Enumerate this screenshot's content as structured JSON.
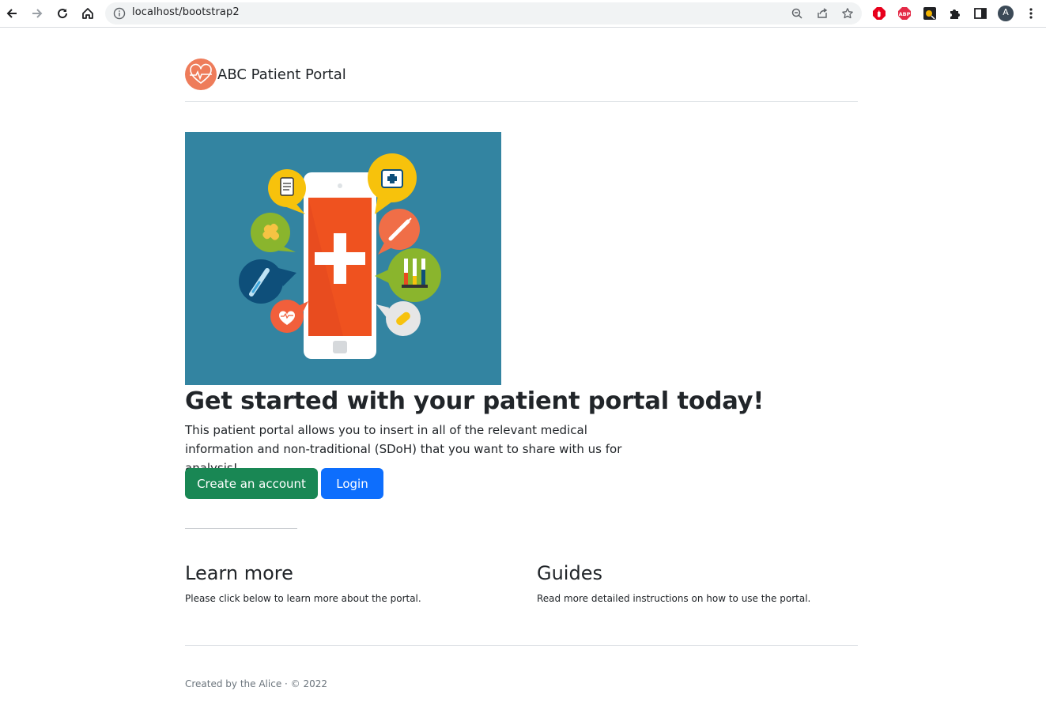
{
  "browser": {
    "url": "localhost/bootstrap2",
    "profile_initial": "A",
    "extensions": [
      "adblock-icon",
      "abp-icon",
      "extension-icon",
      "puzzle-icon"
    ]
  },
  "header": {
    "brand": "ABC Patient Portal"
  },
  "hero": {
    "title": "Get started with your patient portal today!",
    "lead": "This patient portal allows you to insert in all of the relevant medical information and non-traditional (SDoH) that you want to share with us for analysis!",
    "create_label": "Create an account",
    "login_label": "Login"
  },
  "sections": [
    {
      "title": "Learn more",
      "text": "Please click below to learn more about the portal."
    },
    {
      "title": "Guides",
      "text": "Read more detailed instructions on how to use the portal."
    }
  ],
  "footer": {
    "text": "Created by the Alice · © 2022"
  },
  "colors": {
    "brand_logo": "#ee7c5a",
    "hero_bg": "#3384a1",
    "create_button": "#198754",
    "login_button": "#0d6efd"
  }
}
